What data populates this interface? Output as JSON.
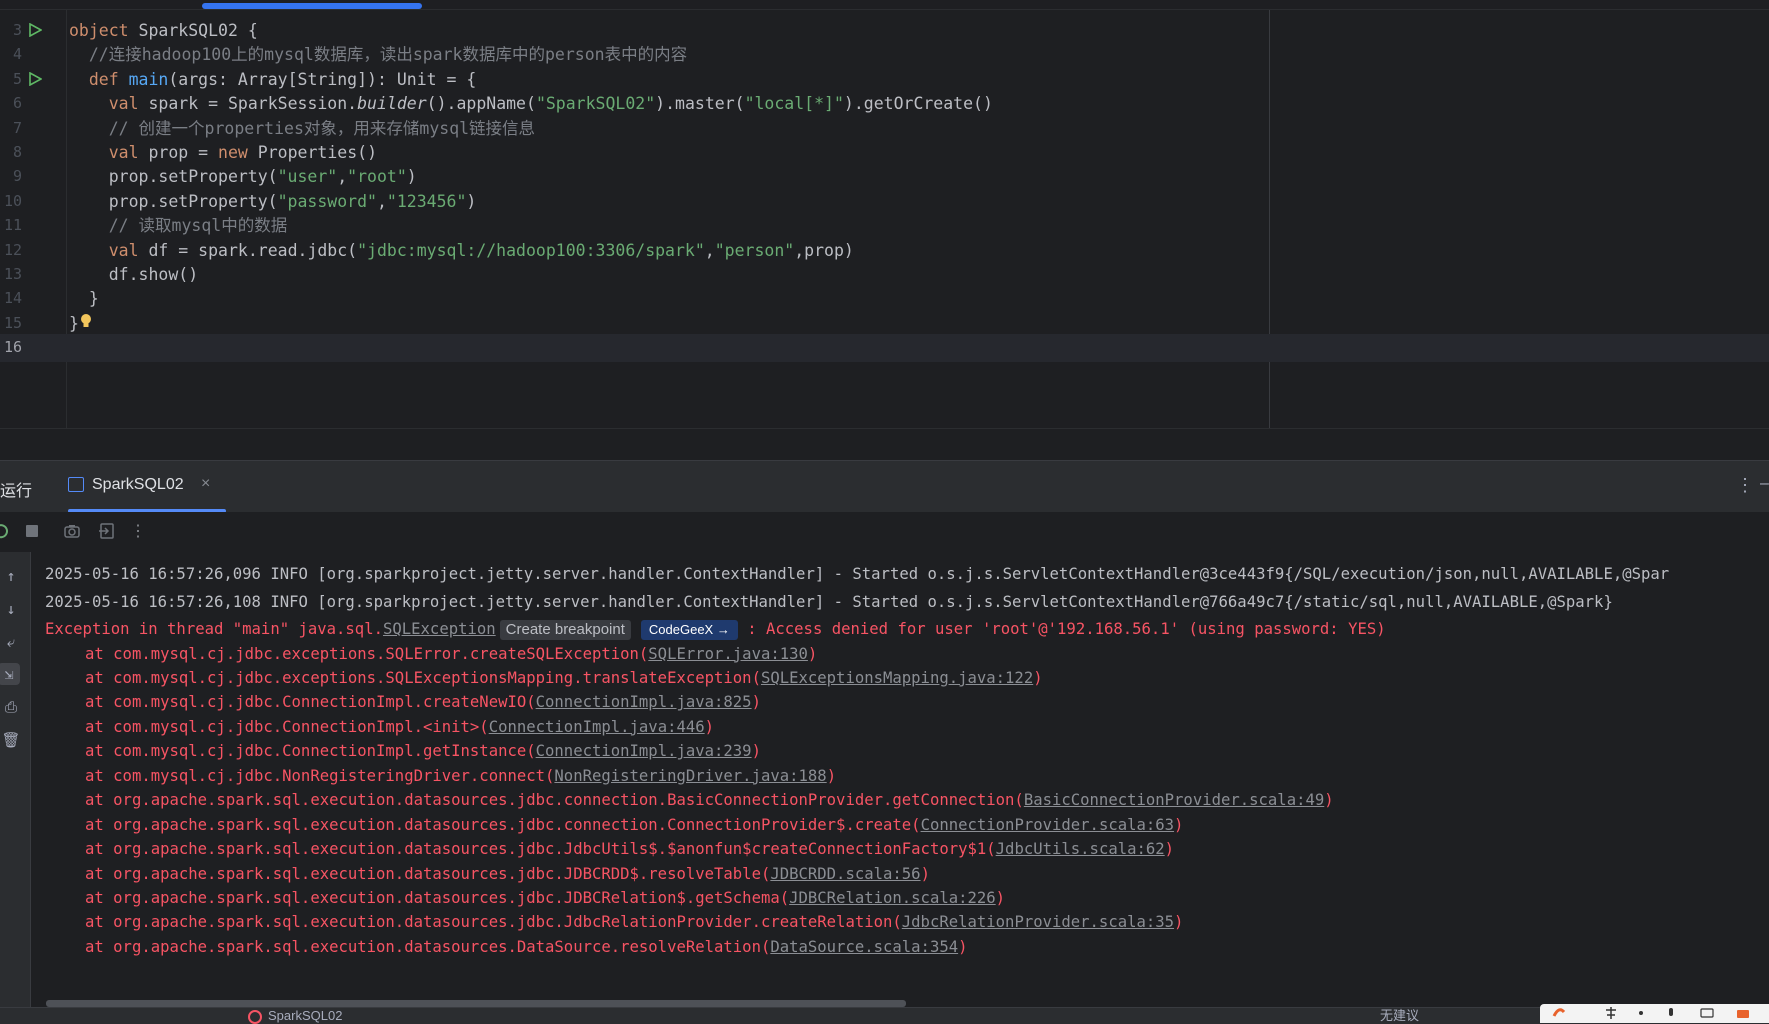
{
  "editor": {
    "lines": [
      {
        "num": "3",
        "run": true,
        "parts": [
          [
            "kw",
            "object"
          ],
          [
            "",
            " SparkSQL02 {"
          ]
        ]
      },
      {
        "num": "4",
        "run": false,
        "parts": [
          [
            "",
            "  "
          ],
          [
            "cmt",
            "//连接hadoop100上的mysql数据库，读出spark数据库中的person表中的内容"
          ]
        ]
      },
      {
        "num": "5",
        "run": true,
        "parts": [
          [
            "",
            "  "
          ],
          [
            "kw",
            "def"
          ],
          [
            "",
            " "
          ],
          [
            "fn",
            "main"
          ],
          [
            "",
            "(args: Array[String]): Unit = {"
          ]
        ]
      },
      {
        "num": "6",
        "run": false,
        "parts": [
          [
            "",
            "    "
          ],
          [
            "kw",
            "val"
          ],
          [
            "",
            " spark = SparkSession."
          ],
          [
            "ital",
            "builder"
          ],
          [
            "",
            "().appName("
          ],
          [
            "str",
            "\"SparkSQL02\""
          ],
          [
            "",
            ").master("
          ],
          [
            "str",
            "\"local[*]\""
          ],
          [
            "",
            ").getOrCreate()"
          ]
        ]
      },
      {
        "num": "7",
        "run": false,
        "parts": [
          [
            "",
            "    "
          ],
          [
            "cmt",
            "// 创建一个properties对象，用来存储mysql链接信息"
          ]
        ]
      },
      {
        "num": "8",
        "run": false,
        "parts": [
          [
            "",
            "    "
          ],
          [
            "kw",
            "val"
          ],
          [
            "",
            " prop = "
          ],
          [
            "kw",
            "new"
          ],
          [
            "",
            " Properties()"
          ]
        ]
      },
      {
        "num": "9",
        "run": false,
        "parts": [
          [
            "",
            "    prop.setProperty("
          ],
          [
            "str",
            "\"user\""
          ],
          [
            "",
            ","
          ],
          [
            "str",
            "\"root\""
          ],
          [
            "",
            ")"
          ]
        ]
      },
      {
        "num": "10",
        "run": false,
        "parts": [
          [
            "",
            "    prop.setProperty("
          ],
          [
            "str",
            "\"password\""
          ],
          [
            "",
            ","
          ],
          [
            "str",
            "\"123456\""
          ],
          [
            "",
            ")"
          ]
        ]
      },
      {
        "num": "11",
        "run": false,
        "parts": [
          [
            "",
            "    "
          ],
          [
            "cmt",
            "// 读取mysql中的数据"
          ]
        ]
      },
      {
        "num": "12",
        "run": false,
        "parts": [
          [
            "",
            "    "
          ],
          [
            "kw",
            "val"
          ],
          [
            "",
            " df = spark.read.jdbc("
          ],
          [
            "str",
            "\"jdbc:mysql://hadoop100:3306/spark\""
          ],
          [
            "",
            ","
          ],
          [
            "str",
            "\"person\""
          ],
          [
            "",
            ",prop)"
          ]
        ]
      },
      {
        "num": "13",
        "run": false,
        "parts": [
          [
            "",
            "    df.show()"
          ]
        ]
      },
      {
        "num": "14",
        "run": false,
        "parts": [
          [
            "",
            "  }"
          ]
        ]
      },
      {
        "num": "15",
        "run": false,
        "bulb": true,
        "parts": [
          [
            "",
            "}"
          ]
        ]
      },
      {
        "num": "16",
        "run": false,
        "current": true,
        "parts": []
      }
    ]
  },
  "toolwindow": {
    "title": "运行",
    "tab_label": "SparkSQL02",
    "tab_close": "×",
    "menu_icon": "⋮"
  },
  "console": {
    "info_lines": [
      "2025-05-16 16:57:26,096 INFO [org.sparkproject.jetty.server.handler.ContextHandler] - Started o.s.j.s.ServletContextHandler@3ce443f9{/SQL/execution/json,null,AVAILABLE,@Spar",
      "2025-05-16 16:57:26,108 INFO [org.sparkproject.jetty.server.handler.ContextHandler] - Started o.s.j.s.ServletContextHandler@766a49c7{/static/sql,null,AVAILABLE,@Spark}"
    ],
    "exception": {
      "prefix": "Exception in thread \"main\" java.sql.",
      "class_link": "SQLException",
      "breakpoint_hint": "Create breakpoint",
      "codegeex_label": "CodeGeeX →",
      "message": " : Access denied for user 'root'@'192.168.56.1' (using password: YES)"
    },
    "stack": [
      {
        "text": "at com.mysql.cj.jdbc.exceptions.SQLError.createSQLException(",
        "link": "SQLError.java:130"
      },
      {
        "text": "at com.mysql.cj.jdbc.exceptions.SQLExceptionsMapping.translateException(",
        "link": "SQLExceptionsMapping.java:122"
      },
      {
        "text": "at com.mysql.cj.jdbc.ConnectionImpl.createNewIO(",
        "link": "ConnectionImpl.java:825"
      },
      {
        "text": "at com.mysql.cj.jdbc.ConnectionImpl.<init>(",
        "link": "ConnectionImpl.java:446"
      },
      {
        "text": "at com.mysql.cj.jdbc.ConnectionImpl.getInstance(",
        "link": "ConnectionImpl.java:239"
      },
      {
        "text": "at com.mysql.cj.jdbc.NonRegisteringDriver.connect(",
        "link": "NonRegisteringDriver.java:188"
      },
      {
        "text": "at org.apache.spark.sql.execution.datasources.jdbc.connection.BasicConnectionProvider.getConnection(",
        "link": "BasicConnectionProvider.scala:49"
      },
      {
        "text": "at org.apache.spark.sql.execution.datasources.jdbc.connection.ConnectionProvider$.create(",
        "link": "ConnectionProvider.scala:63"
      },
      {
        "text": "at org.apache.spark.sql.execution.datasources.jdbc.JdbcUtils$.$anonfun$createConnectionFactory$1(",
        "link": "JdbcUtils.scala:62"
      },
      {
        "text": "at org.apache.spark.sql.execution.datasources.jdbc.JDBCRDD$.resolveTable(",
        "link": "JDBCRDD.scala:56"
      },
      {
        "text": "at org.apache.spark.sql.execution.datasources.jdbc.JDBCRelation$.getSchema(",
        "link": "JDBCRelation.scala:226"
      },
      {
        "text": "at org.apache.spark.sql.execution.datasources.jdbc.JdbcRelationProvider.createRelation(",
        "link": "JdbcRelationProvider.scala:35"
      },
      {
        "text": "at org.apache.spark.sql.execution.datasources.DataSource.resolveRelation(",
        "link": "DataSource.scala:354"
      }
    ]
  },
  "statusbar": {
    "run_label": "SparkSQL02",
    "right_text": "无建议"
  },
  "colors": {
    "accent": "#548af7",
    "error": "#f75464",
    "string": "#6aab73",
    "keyword": "#cf8e6d"
  }
}
